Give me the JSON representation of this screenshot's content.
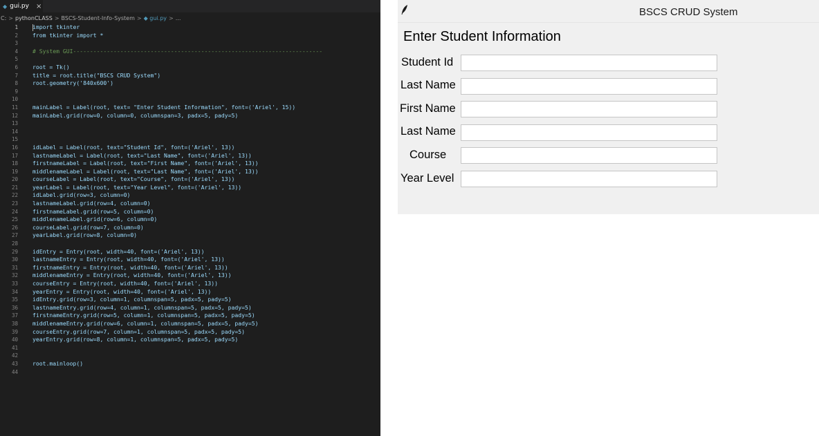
{
  "editor": {
    "tab_icon": "python-file-icon",
    "tab_name": "gui.py",
    "tab_close": "×",
    "breadcrumb": [
      "C:",
      ">",
      "pythonCLASS",
      ">",
      "BSCS-Student-Info-System",
      ">",
      "◆ gui.py",
      ">",
      "..."
    ],
    "lines": [
      {
        "n": "1",
        "code": "import tkinter"
      },
      {
        "n": "2",
        "code": "from tkinter import *"
      },
      {
        "n": "3",
        "code": ""
      },
      {
        "n": "4",
        "code": "# System GUI--------------------------------------------------------------------------"
      },
      {
        "n": "5",
        "code": ""
      },
      {
        "n": "6",
        "code": "root = Tk()"
      },
      {
        "n": "7",
        "code": "title = root.title(\"BSCS CRUD System\")"
      },
      {
        "n": "8",
        "code": "root.geometry('840x600')"
      },
      {
        "n": "9",
        "code": ""
      },
      {
        "n": "10",
        "code": ""
      },
      {
        "n": "11",
        "code": "mainLabel = Label(root, text= \"Enter Student Information\", font=('Ariel', 15))"
      },
      {
        "n": "12",
        "code": "mainLabel.grid(row=0, column=0, columnspan=3, padx=5, pady=5)"
      },
      {
        "n": "13",
        "code": ""
      },
      {
        "n": "14",
        "code": ""
      },
      {
        "n": "15",
        "code": ""
      },
      {
        "n": "16",
        "code": "idLabel = Label(root, text=\"Student Id\", font=('Ariel', 13))"
      },
      {
        "n": "17",
        "code": "lastnameLabel = Label(root, text=\"Last Name\", font=('Ariel', 13))"
      },
      {
        "n": "18",
        "code": "firstnameLabel = Label(root, text=\"First Name\", font=('Ariel', 13))"
      },
      {
        "n": "19",
        "code": "middlenameLabel = Label(root, text=\"Last Name\", font=('Ariel', 13))"
      },
      {
        "n": "20",
        "code": "courseLabel = Label(root, text=\"Course\", font=('Ariel', 13))"
      },
      {
        "n": "21",
        "code": "yearLabel = Label(root, text=\"Year Level\", font=('Ariel', 13))"
      },
      {
        "n": "22",
        "code": "idLabel.grid(row=3, column=0)"
      },
      {
        "n": "23",
        "code": "lastnameLabel.grid(row=4, column=0)"
      },
      {
        "n": "24",
        "code": "firstnameLabel.grid(row=5, column=0)"
      },
      {
        "n": "25",
        "code": "middlenameLabel.grid(row=6, column=0)"
      },
      {
        "n": "26",
        "code": "courseLabel.grid(row=7, column=0)"
      },
      {
        "n": "27",
        "code": "yearLabel.grid(row=8, column=0)"
      },
      {
        "n": "28",
        "code": ""
      },
      {
        "n": "29",
        "code": "idEntry = Entry(root, width=40, font=('Ariel', 13))"
      },
      {
        "n": "30",
        "code": "lastnameEntry = Entry(root, width=40, font=('Ariel', 13))"
      },
      {
        "n": "31",
        "code": "firstnameEntry = Entry(root, width=40, font=('Ariel', 13))"
      },
      {
        "n": "32",
        "code": "middlenameEntry = Entry(root, width=40, font=('Ariel', 13))"
      },
      {
        "n": "33",
        "code": "courseEntry = Entry(root, width=40, font=('Ariel', 13))"
      },
      {
        "n": "34",
        "code": "yearEntry = Entry(root, width=40, font=('Ariel', 13))"
      },
      {
        "n": "35",
        "code": "idEntry.grid(row=3, column=1, columnspan=5, padx=5, pady=5)"
      },
      {
        "n": "36",
        "code": "lastnameEntry.grid(row=4, column=1, columnspan=5, padx=5, pady=5)"
      },
      {
        "n": "37",
        "code": "firstnameEntry.grid(row=5, column=1, columnspan=5, padx=5, pady=5)"
      },
      {
        "n": "38",
        "code": "middlenameEntry.grid(row=6, column=1, columnspan=5, padx=5, pady=5)"
      },
      {
        "n": "39",
        "code": "courseEntry.grid(row=7, column=1, columnspan=5, padx=5, pady=5)"
      },
      {
        "n": "40",
        "code": "yearEntry.grid(row=8, column=1, columnspan=5, padx=5, pady=5)"
      },
      {
        "n": "41",
        "code": ""
      },
      {
        "n": "42",
        "code": ""
      },
      {
        "n": "43",
        "code": "root.mainloop()"
      },
      {
        "n": "44",
        "code": ""
      }
    ]
  },
  "window": {
    "icon": "feather-icon",
    "title": "BSCS CRUD System",
    "heading": "Enter Student Information",
    "fields": [
      {
        "label": "Student Id",
        "value": ""
      },
      {
        "label": "Last Name",
        "value": ""
      },
      {
        "label": "First Name",
        "value": ""
      },
      {
        "label": "Last Name",
        "value": ""
      },
      {
        "label": "Course",
        "value": ""
      },
      {
        "label": "Year Level",
        "value": ""
      }
    ]
  }
}
